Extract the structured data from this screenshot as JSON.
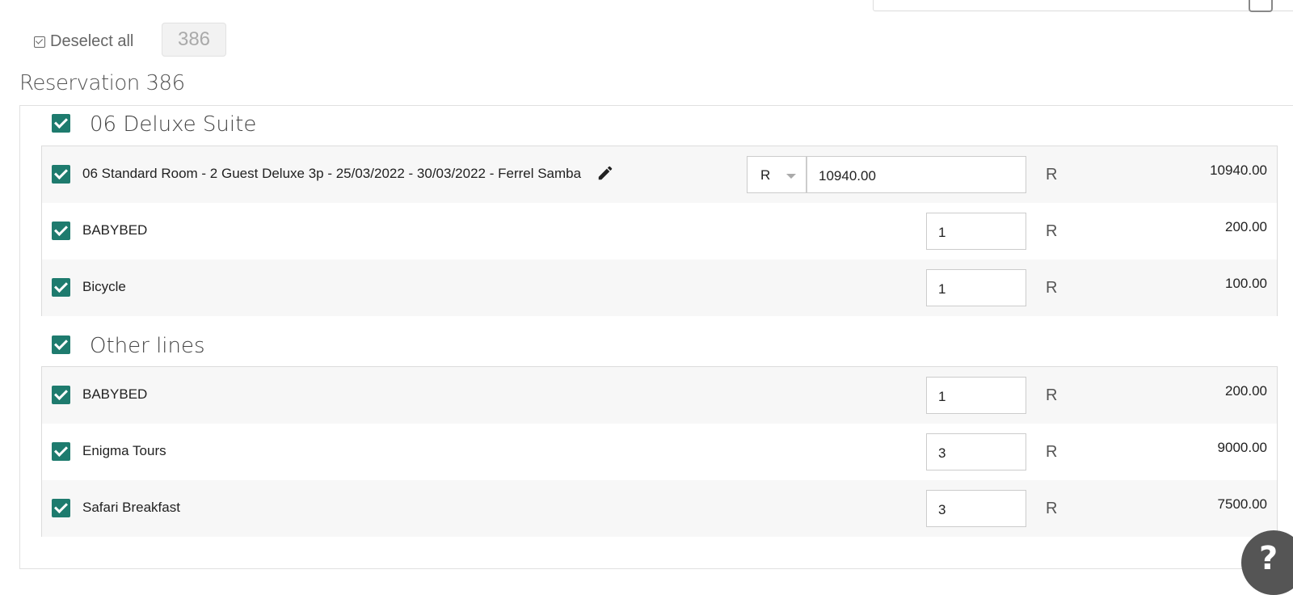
{
  "header": {
    "deselect_label": "Deselect all",
    "reservation_count": "386"
  },
  "reservation": {
    "title": "Reservation 386",
    "groups": [
      {
        "title": "06 Deluxe Suite",
        "lines": [
          {
            "label": "06 Standard Room - 2 Guest Deluxe 3p - 25/03/2022 - 30/03/2022 - Ferrel Samba",
            "currency_select": "R",
            "price_input": "10940.00",
            "currency": "R",
            "amount": "10940.00"
          },
          {
            "label": "BABYBED",
            "qty": "1",
            "currency": "R",
            "amount": "200.00"
          },
          {
            "label": "Bicycle",
            "qty": "1",
            "currency": "R",
            "amount": "100.00"
          }
        ]
      },
      {
        "title": "Other lines",
        "lines": [
          {
            "label": "BABYBED",
            "qty": "1",
            "currency": "R",
            "amount": "200.00"
          },
          {
            "label": "Enigma Tours",
            "qty": "3",
            "currency": "R",
            "amount": "9000.00"
          },
          {
            "label": "Safari Breakfast",
            "qty": "3",
            "currency": "R",
            "amount": "7500.00"
          }
        ]
      }
    ]
  },
  "help_button": {
    "icon": "question-icon",
    "glyph": "?"
  },
  "colors": {
    "checkbox": "#1e7b6e"
  }
}
